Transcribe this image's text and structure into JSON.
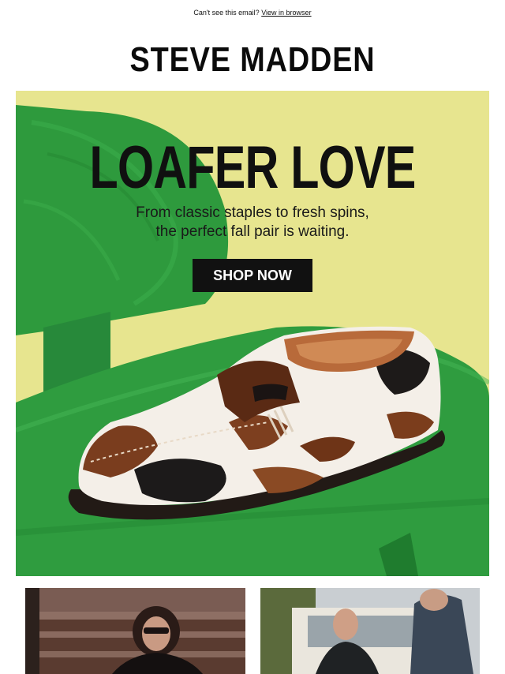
{
  "preheader": {
    "text": "Can't see this email?",
    "link": "View in browser"
  },
  "brand": {
    "name": "STEVE MADDEN"
  },
  "hero": {
    "headline": "LOAFER LOVE",
    "subcopy_line1": "From classic staples to fresh spins,",
    "subcopy_line2": "the perfect fall pair is waiting.",
    "cta": "SHOP NOW"
  },
  "colors": {
    "hero_background": "#e6e48e",
    "chair_green": "#2f9a3e",
    "button": "#111111",
    "text": "#111111"
  }
}
